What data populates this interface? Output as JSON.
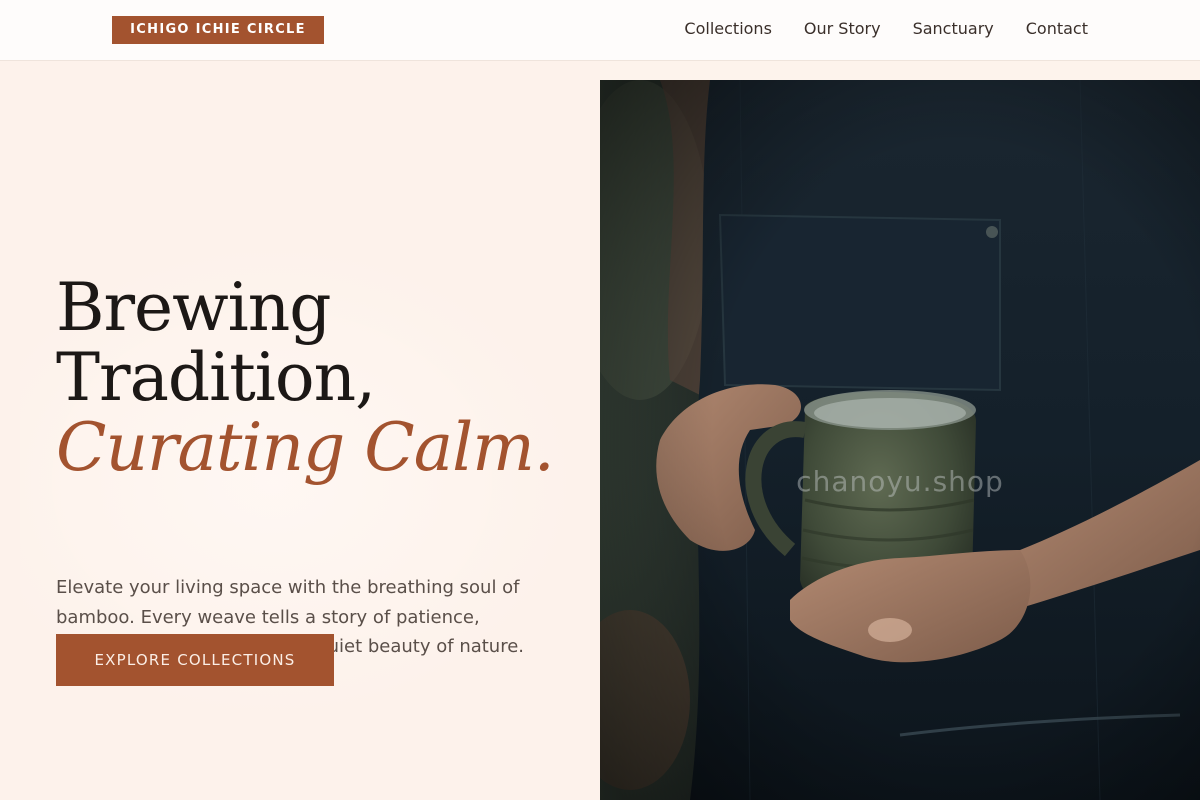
{
  "brand": {
    "name": "ICHIGO ICHIE CIRCLE"
  },
  "nav": {
    "items": [
      {
        "label": "Collections"
      },
      {
        "label": "Our Story"
      },
      {
        "label": "Sanctuary"
      },
      {
        "label": "Contact"
      }
    ]
  },
  "hero": {
    "headline_line1": "Brewing",
    "headline_line2": "Tradition,",
    "headline_accent": "Curating Calm.",
    "lead": "Elevate your living space with the breathing soul of bamboo. Every weave tells a story of patience, sustainable artistry, and the quiet beauty of nature.",
    "cta_label": "EXPLORE COLLECTIONS",
    "image_watermark": "chanoyu.shop"
  },
  "colors": {
    "accent": "#a3532f",
    "background": "#fdf2eb",
    "nav_background": "#fefcfb",
    "heading": "#1c1816",
    "body_text": "#5a4f49"
  }
}
